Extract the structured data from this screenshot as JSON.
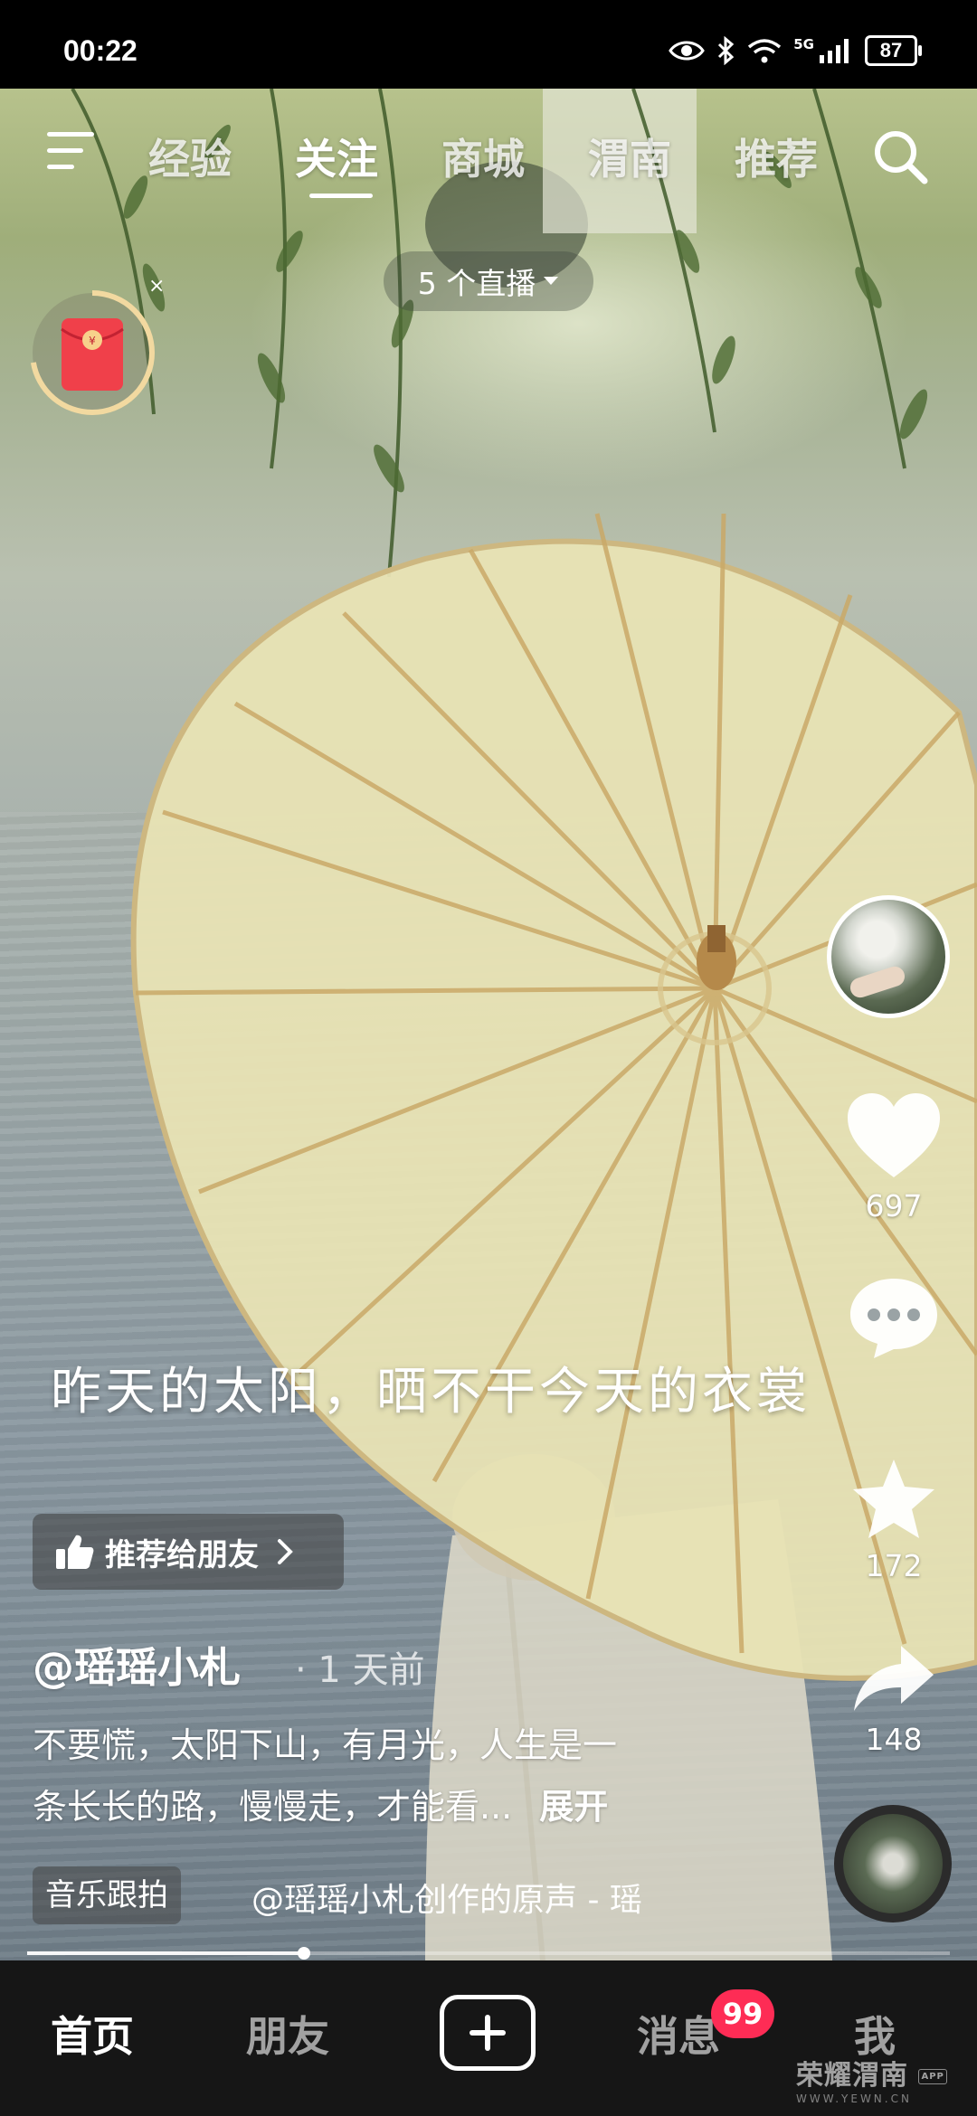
{
  "status_bar": {
    "time": "00:22",
    "network": "5G",
    "battery": "87"
  },
  "top_nav": {
    "tabs": [
      {
        "label": "经验"
      },
      {
        "label": "关注",
        "active": true
      },
      {
        "label": "商城"
      },
      {
        "label": "渭南"
      },
      {
        "label": "推荐"
      }
    ]
  },
  "live": {
    "label": "5 个直播"
  },
  "overlay": {
    "close": "×"
  },
  "right_rail": {
    "likes": "697",
    "favorites": "172",
    "shares": "148"
  },
  "video": {
    "subtitle": "昨天的太阳，晒不干今天的衣裳",
    "recommend_label": "推荐给朋友",
    "author": "@瑶瑶小札",
    "time_ago": "· 1 天前",
    "desc_line1": "不要慌，太阳下山，有月光，人生是一",
    "desc_line2": "条长长的路，慢慢走，才能看...",
    "expand": "展开",
    "music_tag": "音乐跟拍",
    "music_title": "@瑶瑶小札创作的原声 - 瑶",
    "progress": 0.3
  },
  "bottom_nav": {
    "items": [
      {
        "label": "首页",
        "active": true
      },
      {
        "label": "朋友"
      },
      {
        "label": "消息"
      },
      {
        "label": "我"
      }
    ],
    "messages_badge": "99"
  },
  "watermark": {
    "main": "荣耀渭南",
    "sub": "WWW.YEWN.CN",
    "app": "APP"
  },
  "colors": {
    "badge": "#fe2c55",
    "nav_bg": "#161616"
  }
}
